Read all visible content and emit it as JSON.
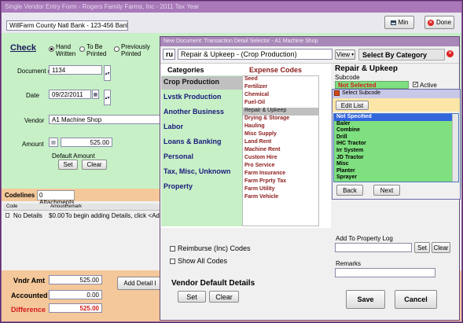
{
  "outer": {
    "title": "Single Vendor Entry Form - Rogers Family Farms, Inc - 2011 Tax Year",
    "bank_field": "WillFarm County Natl Bank - 123-456  Bank",
    "min_label": "Min",
    "done_label": "Done"
  },
  "check": {
    "heading": "Check",
    "radio_hand": "Hand\nWritten",
    "radio_printed": "To Be\nPrinted",
    "radio_prev": "Previously\nPrinted",
    "doc_label": "Document #",
    "doc_value": "1134",
    "date_label": "Date",
    "date_value": "09/22/2011",
    "vendor_label": "Vendor",
    "vendor_value": "A1 Machine Shop",
    "amount_label": "Amount",
    "amount_value": "525.00",
    "default_amount_label": "Default Amount",
    "set_label": "Set",
    "clear_label": "Clear"
  },
  "codelines": {
    "tab_codelines": "Codelines",
    "tab_attachments": "0 Attachments",
    "col_code": "Code",
    "col_amount": "Amount",
    "col_remark": "Remark",
    "row_code": "No Details",
    "row_amount": "$0.00",
    "row_remark": "To begin adding Details, click <Add De"
  },
  "totals": {
    "vndr_amt_label": "Vndr Amt",
    "vndr_amt_value": "525.00",
    "accounted_label": "Accounted",
    "accounted_value": "0.00",
    "difference_label": "Difference",
    "difference_value": "525.00",
    "add_detail_label": "Add Detail I"
  },
  "dialog": {
    "title": "New Document: Transaction Detail Selector - A1 Machine Shop",
    "code_box": "ru",
    "selected_text": "Repair & Upkeep  -  (Crop Production)",
    "view_label": "View",
    "select_by": "Select By Category",
    "categories_heading": "Categories",
    "expense_heading": "Expense Codes",
    "categories": [
      "Crop Production",
      "Lvstk Production",
      "Another Business",
      "Labor",
      "Loans & Banking",
      "Personal",
      "Tax, Misc, Unknown",
      "Property"
    ],
    "expense_codes": [
      "Seed",
      "Fertilizer",
      "Chemical",
      "Fuel-Oil",
      "Repair & Upkeep",
      "Drying & Storage",
      "Hauling",
      "Misc Supply",
      "Land Rent",
      "Machine Rent",
      "Custom Hire",
      "Pro Service",
      "Farm Insurance",
      "Farm Prprty Tax",
      "Farm Utility",
      "Farm Vehicle"
    ],
    "reimburse_label": "Reimburse (Inc) Codes",
    "show_all_label": "Show All Codes",
    "vendor_default_heading": "Vendor Default Details",
    "set_label": "Set",
    "clear_label": "Clear",
    "detail_heading": "Repair & Upkeep",
    "subcode_label": "Subcode",
    "subcode_value": "Not Selected",
    "active_label": "Active",
    "add_property_label": "Add To Property Log",
    "remarks_label": "Remarks",
    "save_label": "Save",
    "cancel_label": "Cancel"
  },
  "subcode_popup": {
    "title": "Select Subcode",
    "edit_list_label": "Edit List",
    "items": [
      "Not Specified",
      "Baler",
      "Combine",
      "Drill",
      "IHC Tractor",
      "Irr System",
      "JD Tractor",
      "Misc",
      "Planter",
      "Sprayer"
    ],
    "back_label": "Back",
    "next_label": "Next"
  }
}
